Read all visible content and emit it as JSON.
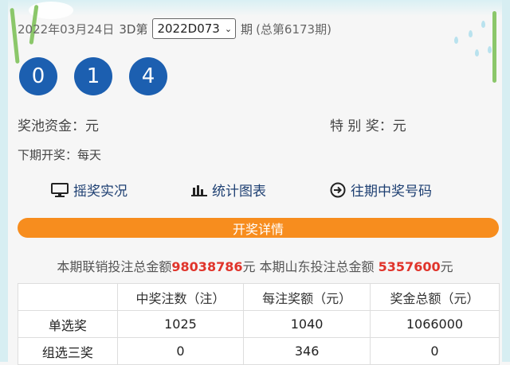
{
  "header": {
    "date": "2022年03月24日",
    "game": "3D第",
    "issue": "2022D073",
    "issue_suffix": "期",
    "total": "(总第6173期)"
  },
  "balls": [
    "0",
    "1",
    "4"
  ],
  "info": {
    "pool_label": "奖池资金：元",
    "special_label": "特 别 奖：元",
    "next_draw": "下期开奖：每天"
  },
  "actions": {
    "live": "摇奖实况",
    "chart": "统计图表",
    "history": "往期中奖号码"
  },
  "detail_bar": "开奖详情",
  "sales": {
    "union_label": "本期联销投注总金额",
    "union_value": "98038786",
    "union_unit": "元 本期山东投注总金额",
    "shandong_value": "5357600",
    "shandong_unit": "元"
  },
  "table": {
    "headers": [
      "",
      "中奖注数（注）",
      "每注奖额（元）",
      "奖金总额（元）"
    ],
    "rows": [
      [
        "单选奖",
        "1025",
        "1040",
        "1066000"
      ],
      [
        "组选三奖",
        "0",
        "346",
        "0"
      ]
    ]
  },
  "colors": {
    "ball": "#1c5fb0",
    "detail_bar": "#f78d1e",
    "highlight": "#e0342b"
  }
}
